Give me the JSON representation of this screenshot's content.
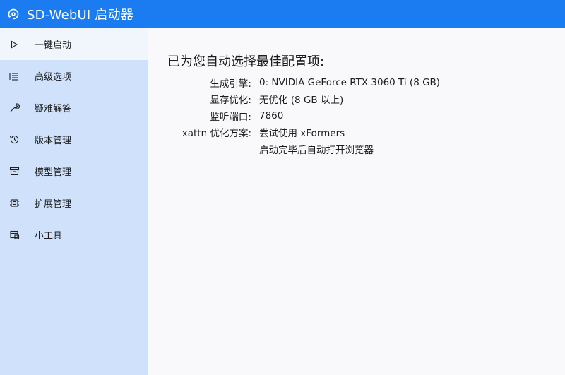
{
  "app": {
    "title": "SD-WebUI 启动器",
    "icon": "refresh-settings-icon",
    "accent": "#1a7cf0"
  },
  "sidebar": {
    "items": [
      {
        "label": "一键启动",
        "icon": "play-icon",
        "active": true
      },
      {
        "label": "高级选项",
        "icon": "list-icon",
        "active": false
      },
      {
        "label": "疑难解答",
        "icon": "wrench-icon",
        "active": false
      },
      {
        "label": "版本管理",
        "icon": "history-icon",
        "active": false
      },
      {
        "label": "模型管理",
        "icon": "archive-icon",
        "active": false
      },
      {
        "label": "扩展管理",
        "icon": "chip-icon",
        "active": false
      },
      {
        "label": "小工具",
        "icon": "toolbox-icon",
        "active": false
      }
    ]
  },
  "main": {
    "heading": "已为您自动选择最佳配置项:",
    "settings": [
      {
        "key": "生成引擎:",
        "value": "0: NVIDIA GeForce RTX 3060 Ti (8 GB)"
      },
      {
        "key": "显存优化:",
        "value": "无优化 (8 GB 以上)"
      },
      {
        "key": "监听端口:",
        "value": "7860"
      },
      {
        "key": "xattn 优化方案:",
        "value": "尝试使用 xFormers"
      },
      {
        "key": "",
        "value": "启动完毕后自动打开浏览器"
      }
    ]
  }
}
